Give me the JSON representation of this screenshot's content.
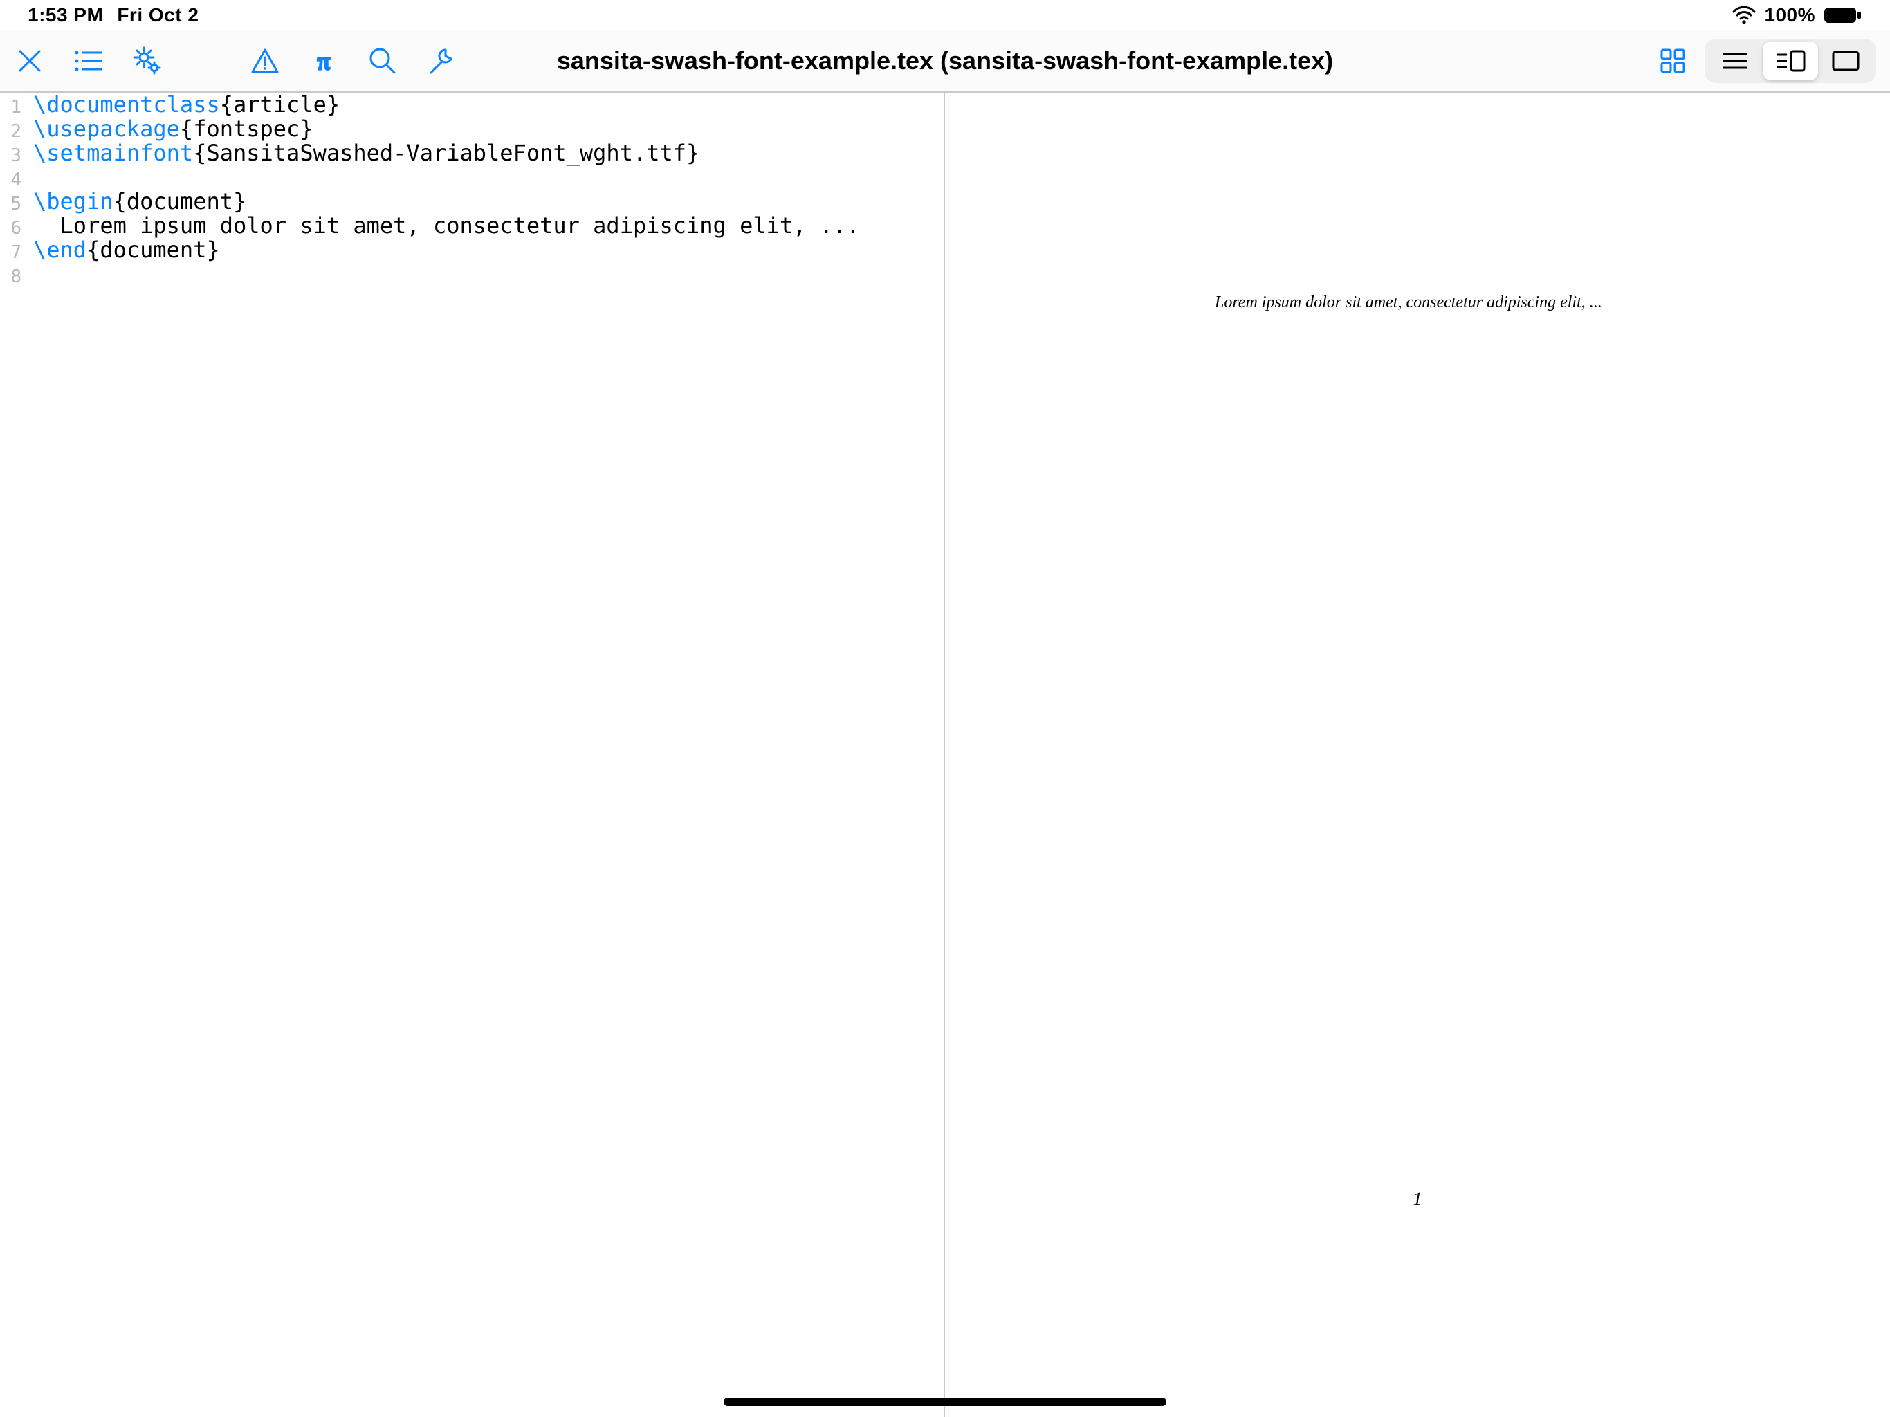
{
  "status": {
    "time": "1:53 PM",
    "date": "Fri Oct 2",
    "battery": "100%"
  },
  "toolbar": {
    "title": "sansita-swash-font-example.tex (sansita-swash-font-example.tex)"
  },
  "editor": {
    "lines": [
      {
        "n": "1",
        "segs": [
          {
            "t": "\\documentclass",
            "c": "cmd"
          },
          {
            "t": "{article}",
            "c": ""
          }
        ]
      },
      {
        "n": "2",
        "segs": [
          {
            "t": "\\usepackage",
            "c": "cmd"
          },
          {
            "t": "{fontspec}",
            "c": ""
          }
        ]
      },
      {
        "n": "3",
        "segs": [
          {
            "t": "\\setmainfont",
            "c": "cmd"
          },
          {
            "t": "{SansitaSwashed-VariableFont_wght.ttf}",
            "c": ""
          }
        ]
      },
      {
        "n": "4",
        "segs": [
          {
            "t": "",
            "c": ""
          }
        ]
      },
      {
        "n": "5",
        "segs": [
          {
            "t": "\\begin",
            "c": "cmd"
          },
          {
            "t": "{document}",
            "c": ""
          }
        ]
      },
      {
        "n": "6",
        "segs": [
          {
            "t": "  Lorem ipsum dolor sit amet, consectetur adipiscing elit, ...",
            "c": ""
          }
        ]
      },
      {
        "n": "7",
        "segs": [
          {
            "t": "\\end",
            "c": "cmd"
          },
          {
            "t": "{document}",
            "c": ""
          }
        ]
      },
      {
        "n": "8",
        "segs": [
          {
            "t": "",
            "c": ""
          }
        ]
      }
    ]
  },
  "preview": {
    "body": "Lorem ipsum dolor sit amet, consectetur adipiscing elit, ...",
    "page_number": "1"
  }
}
